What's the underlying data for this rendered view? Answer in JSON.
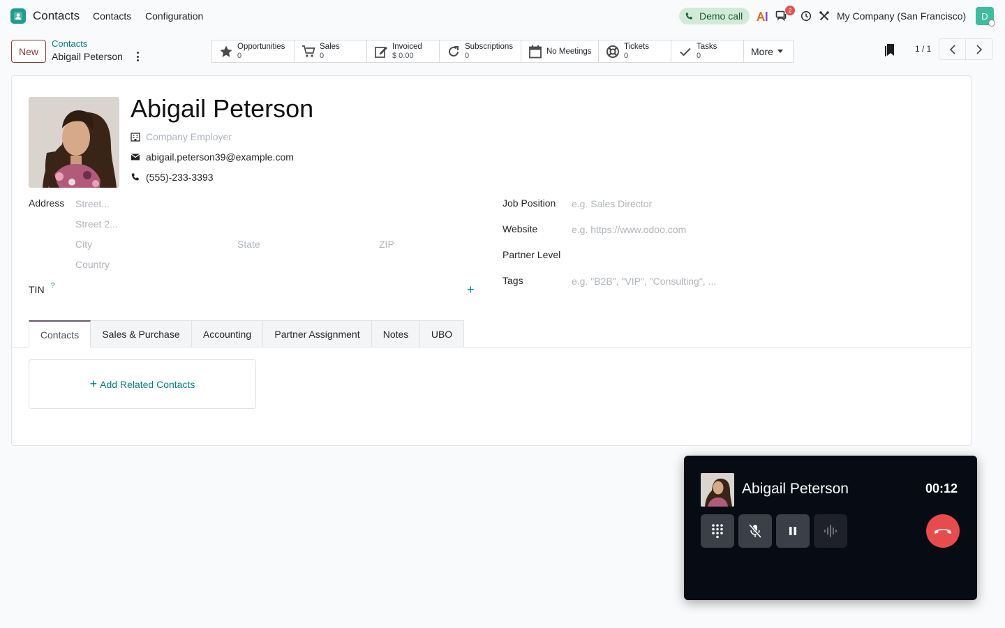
{
  "navbar": {
    "app_name": "Contacts",
    "menu": [
      "Contacts",
      "Configuration"
    ],
    "demo_call": "Demo call",
    "message_badge": "2",
    "company": "My Company (San Francisco)",
    "user_initial": "D",
    "colors": {
      "brand": "#1f9c8f",
      "demo_call_bg": "#d2ebd9",
      "badge": "#e05252",
      "avatar": "#3fbca0"
    },
    "icons": [
      "contacts-app-icon",
      "phone-icon",
      "ai-icon",
      "messages-icon",
      "clock-icon",
      "tools-icon"
    ]
  },
  "control_panel": {
    "new_label": "New",
    "breadcrumb_parent": "Contacts",
    "breadcrumb_current": "Abigail Peterson",
    "smart_buttons": [
      {
        "label": "Opportunities",
        "value": "0",
        "icon": "star-icon"
      },
      {
        "label": "Sales",
        "value": "0",
        "icon": "cart-icon"
      },
      {
        "label": "Invoiced",
        "value": "$ 0.00",
        "icon": "invoice-icon"
      },
      {
        "label": "Subscriptions",
        "value": "0",
        "icon": "refresh-icon"
      },
      {
        "label": "No Meetings",
        "value": "",
        "icon": "calendar-icon"
      },
      {
        "label": "Tickets",
        "value": "0",
        "icon": "lifebuoy-icon"
      },
      {
        "label": "Tasks",
        "value": "0",
        "icon": "check-icon"
      }
    ],
    "more_label": "More",
    "pager": "1 / 1"
  },
  "form": {
    "name": "Abigail Peterson",
    "company_placeholder": "Company Employer",
    "email": "abigail.peterson39@example.com",
    "phone": "(555)-233-3393",
    "address_label": "Address",
    "street_ph": "Street...",
    "street2_ph": "Street 2...",
    "city_ph": "City",
    "state_ph": "State",
    "zip_ph": "ZIP",
    "country_ph": "Country",
    "tin_label": "TIN",
    "tin_help": "?",
    "job_label": "Job Position",
    "job_ph": "e.g. Sales Director",
    "website_label": "Website",
    "website_ph": "e.g. https://www.odoo.com",
    "partner_level_label": "Partner Level",
    "tags_label": "Tags",
    "tags_ph": "e.g. \"B2B\", \"VIP\", \"Consulting\", ...",
    "add_plus": "+"
  },
  "tabs": [
    "Contacts",
    "Sales & Purchase",
    "Accounting",
    "Partner Assignment",
    "Notes",
    "UBO"
  ],
  "add_related_contacts": "Add Related Contacts",
  "call": {
    "name": "Abigail Peterson",
    "timer": "00:12",
    "colors": {
      "bg": "#070b14",
      "hangup": "#e84b4b"
    }
  }
}
